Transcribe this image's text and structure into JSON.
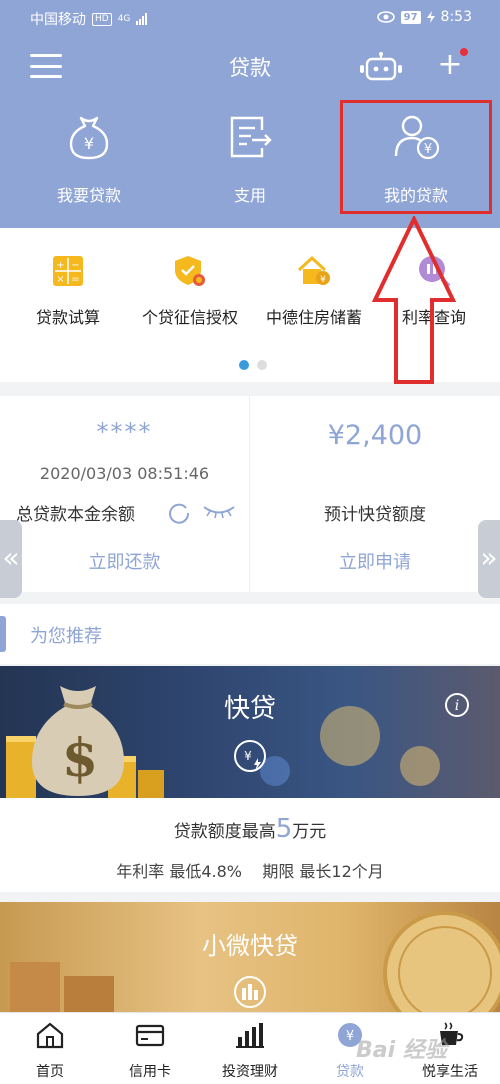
{
  "status_bar": {
    "carrier": "中国移动",
    "hd": "HD",
    "network": "4G",
    "battery": "97",
    "time": "8:53"
  },
  "nav": {
    "title": "贷款"
  },
  "top_functions": [
    {
      "label": "我要贷款",
      "icon": "money-bag-icon"
    },
    {
      "label": "支用",
      "icon": "transfer-document-icon"
    },
    {
      "label": "我的贷款",
      "icon": "user-loan-icon"
    }
  ],
  "quick_functions": [
    {
      "label": "贷款试算",
      "icon": "calculator-icon"
    },
    {
      "label": "个贷征信授权",
      "icon": "shield-badge-icon"
    },
    {
      "label": "中德住房储蓄",
      "icon": "house-icon"
    },
    {
      "label": "利率查询",
      "icon": "rate-search-icon"
    }
  ],
  "summary": {
    "masked_balance": "****",
    "datetime": "2020/03/03 08:51:46",
    "balance_label": "总贷款本金余额",
    "repay_button": "立即还款",
    "amount": "¥2,400",
    "quota_label": "预计快贷额度",
    "apply_button": "立即申请"
  },
  "recommend": {
    "title": "为您推荐",
    "card1": {
      "banner_title": "快贷",
      "line1_prefix": "贷款额度最高",
      "line1_number": "5",
      "line1_suffix": "万元",
      "line2": "年利率 最低4.8%    期限 最长12个月"
    },
    "card2": {
      "banner_title": "小微快贷"
    }
  },
  "bottom_nav": [
    {
      "label": "首页",
      "icon": "home-icon"
    },
    {
      "label": "信用卡",
      "icon": "credit-card-icon"
    },
    {
      "label": "投资理财",
      "icon": "bar-chart-icon"
    },
    {
      "label": "贷款",
      "icon": "yen-coin-icon",
      "active": true
    },
    {
      "label": "悦享生活",
      "icon": "coffee-cup-icon"
    }
  ],
  "watermark": "Bai 经验",
  "colors": {
    "primary": "#8fa5d6",
    "highlight": "#e02d2d",
    "active_dot": "#3a9bdc"
  }
}
